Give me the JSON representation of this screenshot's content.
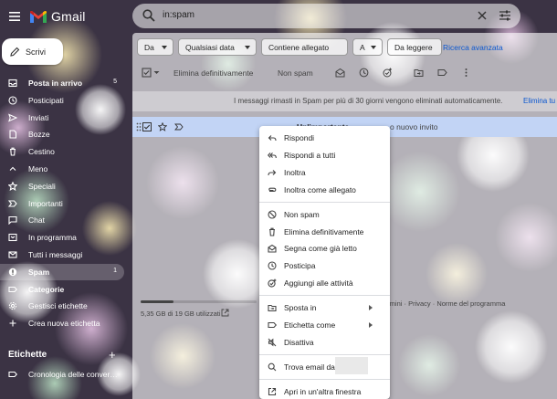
{
  "app": {
    "name": "Gmail"
  },
  "search": {
    "query": "in:spam"
  },
  "compose": {
    "label": "Scrivi"
  },
  "sidebar": {
    "items": [
      {
        "label": "Posta in arrivo",
        "count": "5",
        "icon": "inbox-icon",
        "bold": true
      },
      {
        "label": "Posticipati",
        "icon": "clock-icon"
      },
      {
        "label": "Inviati",
        "icon": "send-icon"
      },
      {
        "label": "Bozze",
        "icon": "draft-icon"
      },
      {
        "label": "Cestino",
        "icon": "trash-icon"
      },
      {
        "label": "Meno",
        "icon": "chevron-up-icon"
      },
      {
        "label": "Speciali",
        "icon": "star-icon"
      },
      {
        "label": "Importanti",
        "icon": "important-icon"
      },
      {
        "label": "Chat",
        "icon": "chat-icon"
      },
      {
        "label": "In programma",
        "icon": "scheduled-icon"
      },
      {
        "label": "Tutti i messaggi",
        "icon": "all-mail-icon"
      },
      {
        "label": "Spam",
        "count": "1",
        "icon": "spam-icon",
        "bold": true,
        "active": true
      },
      {
        "label": "Categorie",
        "icon": "label-icon",
        "bold": true
      },
      {
        "label": "Gestisci etichette",
        "icon": "gear-icon"
      },
      {
        "label": "Crea nuova etichetta",
        "icon": "plus-icon"
      }
    ],
    "labels_heading": "Etichette",
    "labels_add": "+",
    "labels": [
      {
        "label": "Cronologia delle conver…",
        "icon": "label-icon"
      }
    ]
  },
  "filters": {
    "chips": [
      "Da",
      "Qualsiasi data",
      "Contiene allegato",
      "A",
      "Da leggere"
    ],
    "advanced": "Ricerca avanzata"
  },
  "toolbar": {
    "delete_forever": "Elimina definitivamente",
    "not_spam": "Non spam"
  },
  "info": {
    "text": "I messaggi rimasti in Spam per più di 30 giorni vengono eliminati automaticamente.",
    "link": "Elimina tu"
  },
  "mail_row": {
    "sender": "Un'importante",
    "subject": "o nuovo invito"
  },
  "storage": {
    "text": "5,35 GB di 19 GB utilizzati",
    "fraction": 0.28
  },
  "footer": {
    "links": "ermini · Privacy · Norme del programma"
  },
  "context_menu": {
    "groups": [
      [
        {
          "label": "Rispondi",
          "icon": "reply-icon"
        },
        {
          "label": "Rispondi a tutti",
          "icon": "reply-all-icon"
        },
        {
          "label": "Inoltra",
          "icon": "forward-icon"
        },
        {
          "label": "Inoltra come allegato",
          "icon": "attachment-icon"
        }
      ],
      [
        {
          "label": "Non spam",
          "icon": "not-spam-icon"
        },
        {
          "label": "Elimina definitivamente",
          "icon": "trash-icon"
        },
        {
          "label": "Segna come già letto",
          "icon": "mark-read-icon"
        },
        {
          "label": "Posticipa",
          "icon": "clock-icon"
        },
        {
          "label": "Aggiungi alle attività",
          "icon": "add-task-icon"
        }
      ],
      [
        {
          "label": "Sposta in",
          "icon": "folder-move-icon",
          "submenu": true
        },
        {
          "label": "Etichetta come",
          "icon": "label-icon",
          "submenu": true
        },
        {
          "label": "Disattiva",
          "icon": "mute-icon"
        }
      ],
      [
        {
          "label": "Trova email da",
          "icon": "search-icon"
        }
      ],
      [
        {
          "label": "Apri in un'altra finestra",
          "icon": "open-in-new-icon"
        }
      ]
    ]
  },
  "colors": {
    "accent": "#0b57d0",
    "selected_row": "#c2d4f5",
    "gmail_red": "#ea4335",
    "gmail_blue": "#4285f4",
    "gmail_green": "#34a853",
    "gmail_yellow": "#fbbc04"
  }
}
